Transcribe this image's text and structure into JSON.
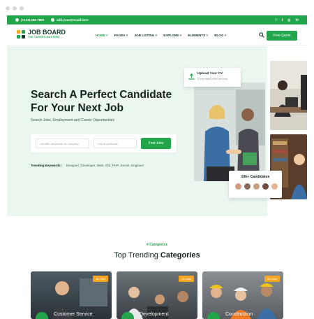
{
  "topbar": {
    "phone": "(+123) 456 7890",
    "email": "add.your@email.here",
    "social": [
      "f",
      "t",
      "◎",
      "in"
    ]
  },
  "nav": {
    "logo_title": "JOB BOARD",
    "logo_tagline": "THE CAREER MASTERS",
    "items": [
      "HOME",
      "PAGES",
      "JOB LISTING",
      "EXPLORE",
      "ELEMENTS",
      "BLOG"
    ],
    "quote_label": "Free Quote"
  },
  "hero": {
    "title": "Search A Perfect Candidate For Your Next Job",
    "subtitle": "Search Jobs, Employment and Career Opportunities",
    "keywords_placeholder": "Job title, keywords, or company",
    "location_placeholder": "City or postcode",
    "find_label": "Find Jobs",
    "trending_label": "Trending Keywords :",
    "trending_values": "Designer, Developer, Web, IOS, PHP, Senior, Engineer",
    "upload_title": "Upload Your CV",
    "upload_sub": "It only takes a few seconds",
    "candidates": "10k+ Candidates"
  },
  "categories": {
    "eyebrow": "# Categories",
    "title_a": "Top Trending",
    "title_b": " Categories",
    "cards": [
      {
        "label": "Customer Service",
        "badge": "36 Jobs"
      },
      {
        "label": "Development",
        "badge": "12 Jobs"
      },
      {
        "label": "Construction",
        "badge": "55 Jobs"
      }
    ]
  },
  "colors": {
    "accent": "#23a54b",
    "hero_bg": "#eaf6ee",
    "badge": "#f5a623"
  }
}
